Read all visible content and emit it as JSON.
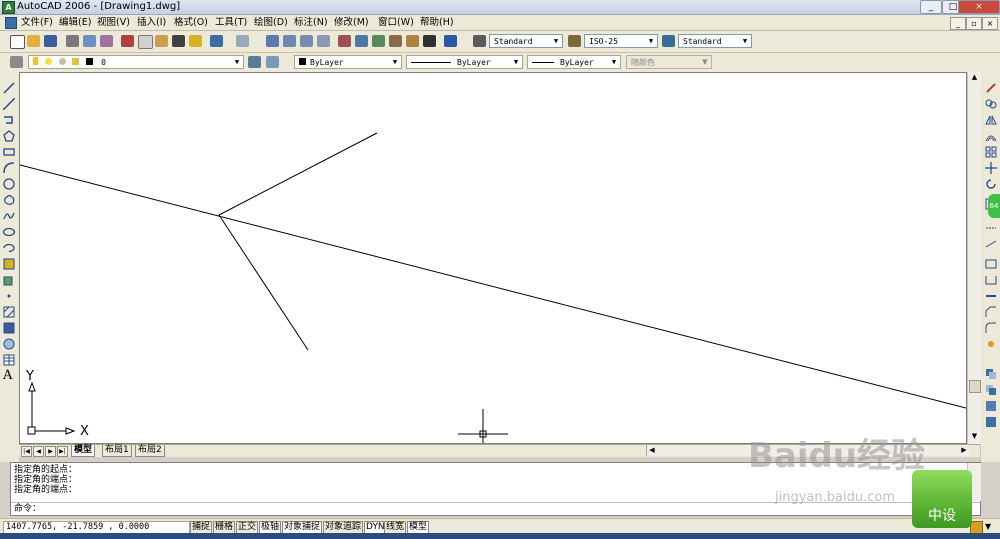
{
  "window": {
    "title": "AutoCAD 2006 - [Drawing1.dwg]",
    "app_icon": "autocad-icon",
    "minimize": "_",
    "maximize": "□",
    "close": "×"
  },
  "menubar": {
    "items": [
      "文件(F)",
      "编辑(E)",
      "视图(V)",
      "插入(I)",
      "格式(O)",
      "工具(T)",
      "绘图(D)",
      "标注(N)",
      "修改(M)",
      "窗口(W)",
      "帮助(H)"
    ],
    "doc_controls": [
      "_",
      "▫",
      "×"
    ]
  },
  "toolbar_standard": {
    "text_style_value": "Standard",
    "dim_style_value": "ISO-25",
    "table_style_value": "Standard"
  },
  "toolbar_layers": {
    "layer_value": "0",
    "color_value": "ByLayer",
    "linetype_value": "ByLayer",
    "lineweight_value": "ByLayer",
    "plotstyle_value": "随颜色"
  },
  "colors": {
    "accent": "#3a6ea5",
    "canvas": "#ffffff",
    "chrome": "#ece9d8",
    "titlebar": "#c3d1e4",
    "close_button": "#c84b3a",
    "linework": "#000000"
  },
  "drawing": {
    "ucs_x_label": "X",
    "ucs_y_label": "Y"
  },
  "layout_tabs": [
    "模型",
    "布局1",
    "布局2"
  ],
  "active_tab": "模型",
  "command_history": [
    "指定角的起点：",
    "指定角的端点：",
    "指定角的端点："
  ],
  "command_prompt": "命令：",
  "status": {
    "coordinates": "1407.7765, -21.7859 , 0.0000",
    "toggles": [
      "捕捉",
      "栅格",
      "正交",
      "极轴",
      "对象捕捉",
      "对象追踪",
      "DYN",
      "线宽",
      "模型"
    ]
  },
  "watermark": {
    "text": "Baidu经验",
    "url": "jingyan.baidu.com",
    "badge_text": "中设"
  },
  "side_tab_label": "64"
}
